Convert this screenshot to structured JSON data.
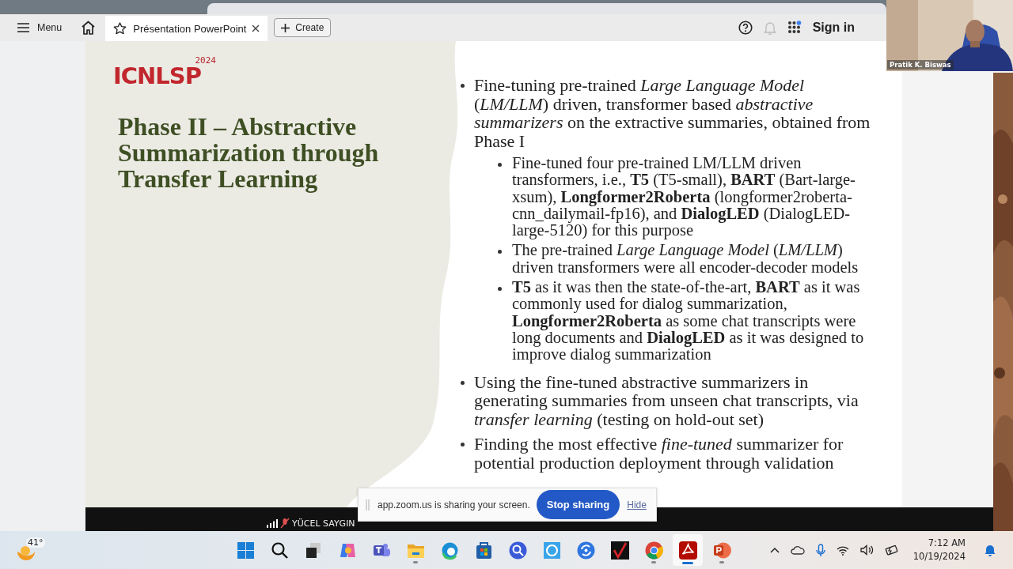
{
  "browser_toolbar": {
    "menu_label": "Menu",
    "tab": {
      "label": "Présentation PowerPoint",
      "selected": true
    },
    "create_label": "Create",
    "sign_in": "Sign in"
  },
  "camera": {
    "participant": "Pratik K. Biswas"
  },
  "slide": {
    "logo": {
      "name": "ICNLSP",
      "year": "2024"
    },
    "title": "Phase II – Abstractive Summarization through Transfer Learning",
    "bullets": [
      {
        "text": "Fine-tuning pre-trained *Large Language Model* (*LM/LLM*) driven, transformer based *abstractive summarizers* on the extractive summaries, obtained from Phase I",
        "children": [
          {
            "text": "Fine-tuned four pre-trained LM/LLM driven transformers, i.e., **T5** (T5-small), **BART** (Bart-large-xsum), **Longformer2Roberta** (longformer2roberta-cnn_dailymail-fp16), and **DialogLED** (DialogLED-large-5120) for this purpose"
          },
          {
            "text": "The pre-trained *Large Language Model* (*LM/LLM*) driven transformers were all encoder-decoder models"
          },
          {
            "text": "**T5** as it was then the state-of-the-art, **BART** as it was commonly used for dialog summarization, **Longformer2Roberta** as some chat transcripts were long documents and **DialogLED** as it was designed to improve dialog summarization"
          }
        ]
      },
      {
        "text": "Using the fine-tuned abstractive summarizers in generating summaries from unseen chat transcripts, via *transfer learning* (testing on hold-out set)"
      },
      {
        "text": "Finding the most effective *fine-tuned* summarizer for potential production deployment through validation"
      }
    ]
  },
  "meeting_bar": {
    "participant": "YÜCEL SAYGIN"
  },
  "share_notice": {
    "message": "app.zoom.us is sharing your screen.",
    "stop_button": "Stop sharing",
    "hide_link": "Hide"
  },
  "taskbar": {
    "weather": "41°",
    "apps": [
      {
        "kind": "start",
        "running": false,
        "active": false
      },
      {
        "kind": "search",
        "running": false,
        "active": false
      },
      {
        "kind": "taskview",
        "running": false,
        "active": false
      },
      {
        "kind": "copilot",
        "running": false,
        "active": false
      },
      {
        "kind": "teams",
        "running": false,
        "active": false
      },
      {
        "kind": "files",
        "running": true,
        "active": false
      },
      {
        "kind": "edge",
        "running": false,
        "active": false
      },
      {
        "kind": "store",
        "running": false,
        "active": false
      },
      {
        "kind": "finder",
        "running": false,
        "active": false
      },
      {
        "kind": "circle",
        "running": false,
        "active": false
      },
      {
        "kind": "sync",
        "running": false,
        "active": false
      },
      {
        "kind": "check",
        "running": false,
        "active": false
      },
      {
        "kind": "chrome",
        "running": true,
        "active": false
      },
      {
        "kind": "pdf",
        "running": true,
        "active": true
      },
      {
        "kind": "slides",
        "running": true,
        "active": false
      }
    ],
    "time": "7:12 AM",
    "date": "10/19/2024"
  }
}
